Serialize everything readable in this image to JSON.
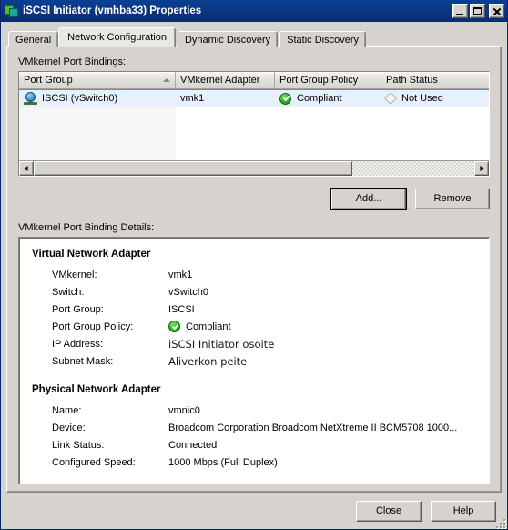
{
  "window": {
    "title": "iSCSI Initiator (vmhba33) Properties",
    "app_icon": "vmware-squares-icon",
    "controls": {
      "minimize": "minimize-icon",
      "maximize": "maximize-icon",
      "close": "close-icon"
    }
  },
  "tabs": [
    {
      "label": "General",
      "active": false
    },
    {
      "label": "Network Configuration",
      "active": true
    },
    {
      "label": "Dynamic Discovery",
      "active": false
    },
    {
      "label": "Static Discovery",
      "active": false
    }
  ],
  "port_bindings": {
    "label": "VMkernel Port Bindings:",
    "columns": [
      "Port Group",
      "VMkernel Adapter",
      "Port Group Policy",
      "Path Status"
    ],
    "sort_column": "Port Group",
    "sort_direction": "ascending",
    "rows": [
      {
        "port_group": "ISCSI (vSwitch0)",
        "port_group_icon": "network-globe-icon",
        "vmkernel_adapter": "vmk1",
        "port_group_policy": "Compliant",
        "policy_icon": "green-check-icon",
        "path_status": "Not Used",
        "path_status_icon": "gray-diamond-icon",
        "selected": true
      }
    ]
  },
  "list_buttons": {
    "add": "Add...",
    "remove": "Remove"
  },
  "details": {
    "label": "VMkernel Port Binding Details:",
    "virtual_adapter": {
      "title": "Virtual Network Adapter",
      "fields": [
        {
          "label": "VMkernel:",
          "value": "vmk1"
        },
        {
          "label": "Switch:",
          "value": "vSwitch0"
        },
        {
          "label": "Port Group:",
          "value": "ISCSI"
        },
        {
          "label": "Port Group Policy:",
          "value": "Compliant",
          "icon": "green-check-icon"
        },
        {
          "label": "IP Address:",
          "value": "iSCSI Initiator osoite"
        },
        {
          "label": "Subnet Mask:",
          "value": "Aliverkon peite"
        }
      ]
    },
    "physical_adapter": {
      "title": "Physical Network Adapter",
      "fields": [
        {
          "label": "Name:",
          "value": "vmnic0"
        },
        {
          "label": "Device:",
          "value": "Broadcom Corporation Broadcom NetXtreme II BCM5708 1000..."
        },
        {
          "label": "Link Status:",
          "value": "Connected"
        },
        {
          "label": "Configured Speed:",
          "value": "1000 Mbps (Full Duplex)"
        }
      ]
    }
  },
  "footer": {
    "close": "Close",
    "help": "Help"
  },
  "colors": {
    "titlebar": "#0a2d6e",
    "face": "#d6d3ce",
    "selection": "#e8f1fb",
    "compliant_green": "#2fae27"
  }
}
